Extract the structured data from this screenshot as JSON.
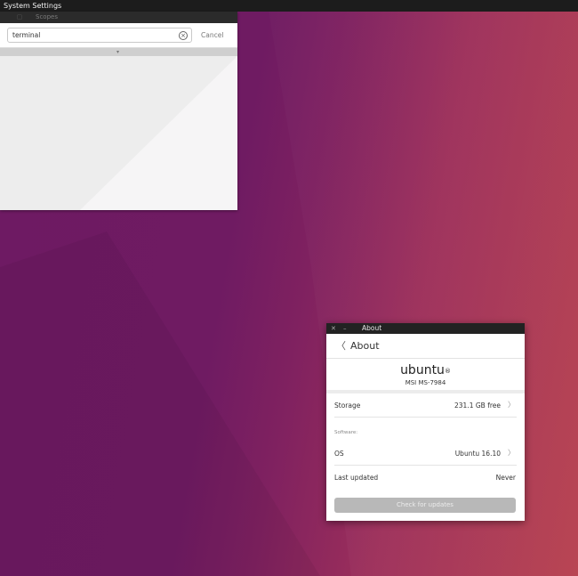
{
  "top_bar": {
    "title": "System Settings"
  },
  "settings": {
    "scopes_label": "Scopes",
    "search_value": "terminal",
    "cancel_label": "Cancel"
  },
  "about": {
    "window_title": "About",
    "header_title": "About",
    "brand": "ubuntu",
    "brand_mark": "®",
    "device_model": "MSI MS-7984",
    "storage": {
      "label": "Storage",
      "value": "231.1 GB free"
    },
    "software_header": "Software:",
    "os": {
      "label": "OS",
      "value": "Ubuntu 16.10"
    },
    "last_updated": {
      "label": "Last updated",
      "value": "Never"
    },
    "check_button": "Check for updates"
  },
  "icons": {
    "scopes": "scopes-icon",
    "clear": "clear-search-icon",
    "collapse": "collapse-handle-icon",
    "close": "close-icon",
    "minimize": "minimize-icon",
    "back": "back-chevron-icon",
    "row_chevron": "chevron-right-icon"
  },
  "colors": {
    "panel": "#1c1c1c",
    "wallpaper_left": "#6e1a63",
    "wallpaper_right": "#b63e4c",
    "button_disabled": "#b8b8b8"
  }
}
